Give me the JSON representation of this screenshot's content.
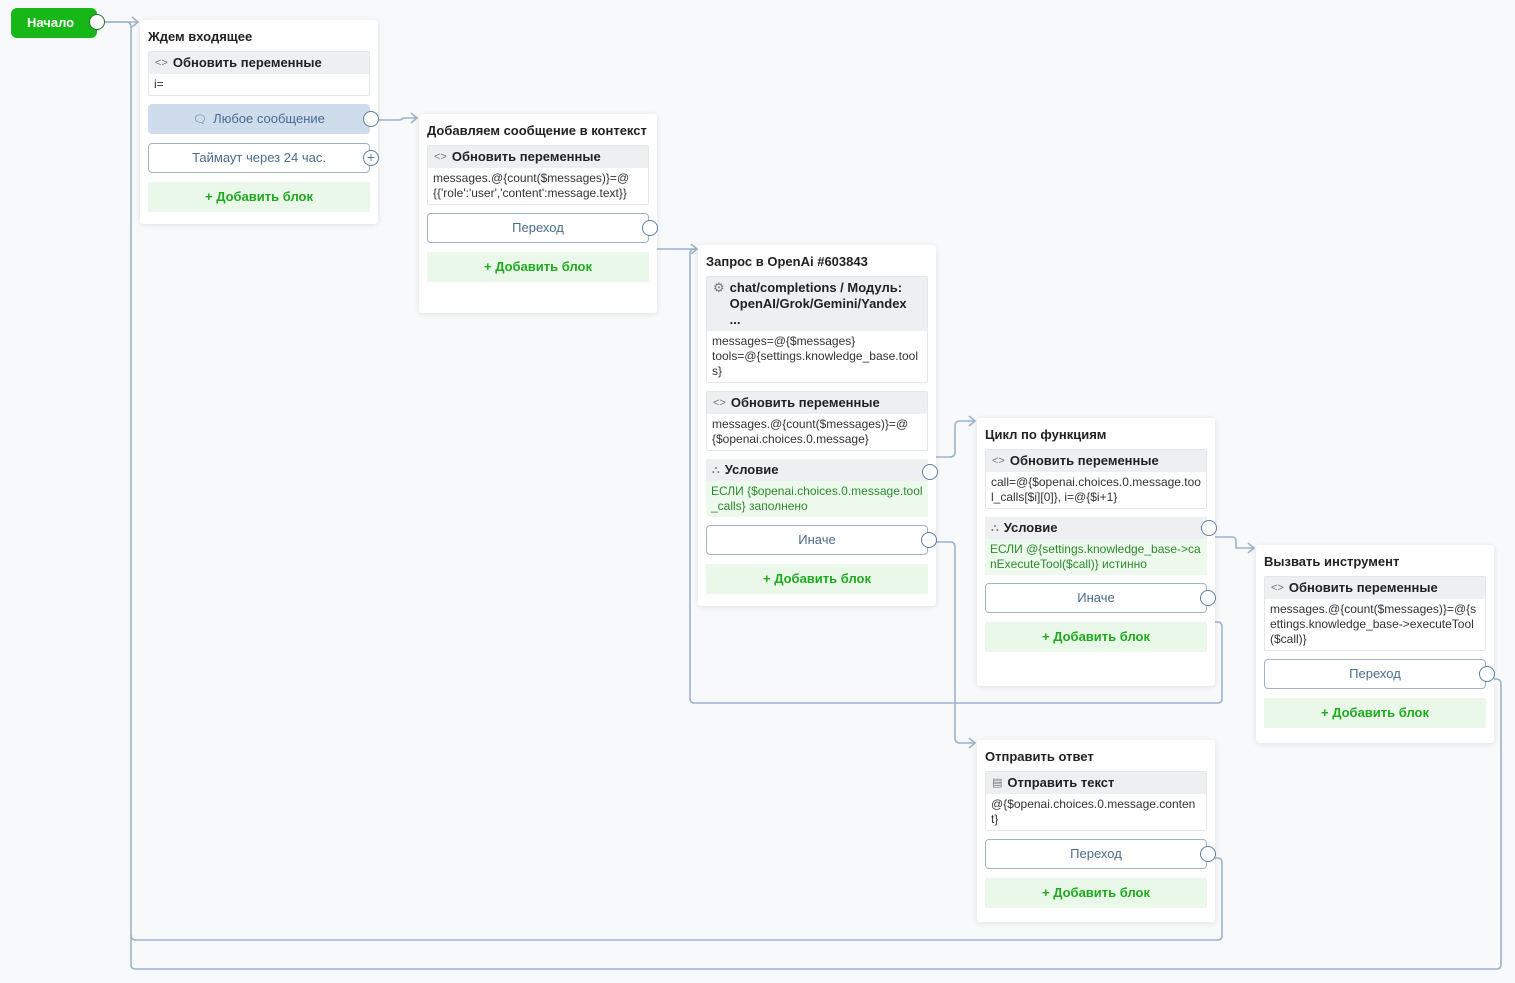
{
  "start": {
    "label": "Начало"
  },
  "nodes": {
    "wait": {
      "title": "Ждем входящее",
      "update": {
        "head": "Обновить переменные",
        "body": "i="
      },
      "any_message": "Любое сообщение",
      "timeout": "Таймаут через 24 час.",
      "add": "+ Добавить блок"
    },
    "add_context": {
      "title": "Добавляем сообщение в контекст",
      "update": {
        "head": "Обновить переменные",
        "body": "messages.@{count($messages)}=@{{'role':'user','content':message.text}}"
      },
      "transition": "Переход",
      "add": "+ Добавить блок"
    },
    "openai": {
      "title": "Запрос в OpenAi #603843",
      "module": {
        "head": "chat/completions / Модуль: OpenAI/Grok/Gemini/Yandex ...",
        "body_line1": "messages=@{$messages}",
        "body_line2": "tools=@{settings.knowledge_base.tools}"
      },
      "update": {
        "head": "Обновить переменные",
        "body": "messages.@{count($messages)}=@{$openai.choices.0.message}"
      },
      "condition": {
        "head": "Условие",
        "body": "ЕСЛИ {$openai.choices.0.message.tool_calls} заполнено"
      },
      "else": "Иначе",
      "add": "+ Добавить блок"
    },
    "loop": {
      "title": "Цикл по функциям",
      "update": {
        "head": "Обновить переменные",
        "body": "call=@{$openai.choices.0.message.tool_calls[$i][0]}, i=@{$i+1}"
      },
      "condition": {
        "head": "Условие",
        "body": "ЕСЛИ @{settings.knowledge_base->canExecuteTool($call)} истинно"
      },
      "else": "Иначе",
      "add": "+ Добавить блок"
    },
    "send": {
      "title": "Отправить ответ",
      "text": {
        "head": "Отправить текст",
        "body": "@{$openai.choices.0.message.content}"
      },
      "transition": "Переход",
      "add": "+ Добавить блок"
    },
    "tool": {
      "title": "Вызвать инструмент",
      "update": {
        "head": "Обновить переменные",
        "body": "messages.@{count($messages)}=@{settings.knowledge_base->executeTool($call)}"
      },
      "transition": "Переход",
      "add": "+ Добавить блок"
    }
  },
  "colors": {
    "wire": "#9db3cc",
    "accent_green": "#17b717",
    "port": "#5a7da6"
  }
}
